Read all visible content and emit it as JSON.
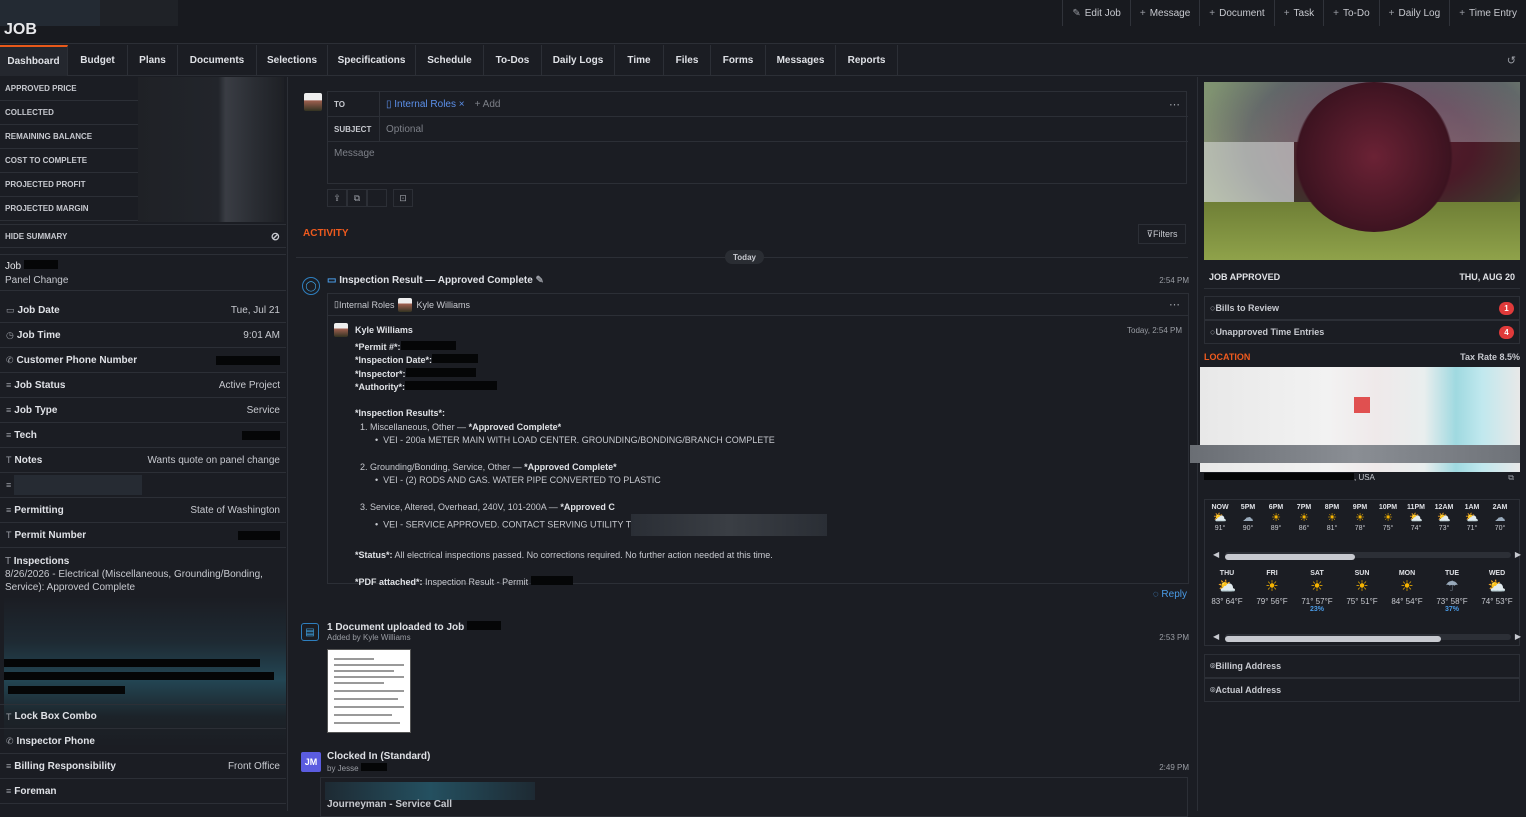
{
  "header": {
    "title": "JOB",
    "actions": [
      {
        "icon": "edit-icon",
        "label": "Edit Job"
      },
      {
        "icon": "plus-icon",
        "label": "Message"
      },
      {
        "icon": "plus-icon",
        "label": "Document"
      },
      {
        "icon": "plus-icon",
        "label": "Task"
      },
      {
        "icon": "plus-icon",
        "label": "To-Do"
      },
      {
        "icon": "plus-icon",
        "label": "Daily Log"
      },
      {
        "icon": "plus-icon",
        "label": "Time Entry"
      }
    ]
  },
  "tabs": [
    "Dashboard",
    "Budget",
    "Plans",
    "Documents",
    "Selections",
    "Specifications",
    "Schedule",
    "To-Dos",
    "Daily Logs",
    "Time",
    "Files",
    "Forms",
    "Messages",
    "Reports"
  ],
  "summary": {
    "rows": [
      "APPROVED PRICE",
      "COLLECTED",
      "REMAINING BALANCE",
      "COST TO COMPLETE",
      "PROJECTED PROFIT",
      "PROJECTED MARGIN"
    ],
    "hide_label": "HIDE SUMMARY"
  },
  "job": {
    "label": "Job",
    "subtitle": "Panel Change"
  },
  "fields": [
    {
      "icon": "calendar-icon",
      "label": "Job Date",
      "value": "Tue, Jul 21"
    },
    {
      "icon": "clock-icon",
      "label": "Job Time",
      "value": "9:01 AM"
    },
    {
      "icon": "phone-icon",
      "label": "Customer Phone Number",
      "value": ""
    },
    {
      "icon": "list-icon",
      "label": "Job Status",
      "value": "Active Project"
    },
    {
      "icon": "list-icon",
      "label": "Job Type",
      "value": "Service"
    },
    {
      "icon": "list-icon",
      "label": "Tech",
      "value": ""
    },
    {
      "icon": "text-icon",
      "label": "Notes",
      "value": "Wants quote on panel change"
    },
    {
      "icon": "list-icon",
      "label": "Permitting",
      "value": "State of Washington"
    },
    {
      "icon": "text-icon",
      "label": "Permit Number",
      "value": ""
    }
  ],
  "inspections": {
    "label": "Inspections",
    "text": "8/26/2026 - Electrical (Miscellaneous, Grounding/Bonding, Service): Approved Complete"
  },
  "fields_bottom": [
    {
      "icon": "text-icon",
      "label": "Lock Box Combo",
      "value": ""
    },
    {
      "icon": "phone-icon",
      "label": "Inspector Phone",
      "value": ""
    },
    {
      "icon": "list-icon",
      "label": "Billing Responsibility",
      "value": "Front Office"
    },
    {
      "icon": "list-icon",
      "label": "Foreman",
      "value": ""
    }
  ],
  "compose": {
    "to_label": "TO",
    "recipient": "Internal Roles",
    "add_label": "+ Add",
    "subject_label": "SUBJECT",
    "subject_placeholder": "Optional",
    "message_placeholder": "Message"
  },
  "activity": {
    "title": "ACTIVITY",
    "filters_label": "Filters",
    "today_label": "Today",
    "inspection": {
      "title": "Inspection Result — Approved Complete",
      "time": "2:54 PM",
      "recipients": [
        "Internal Roles",
        "Kyle Williams"
      ],
      "author": "Kyle Williams",
      "author_time": "Today, 2:54 PM",
      "permit_label": "*Permit #*:",
      "date_label": "*Inspection Date*:",
      "inspector_label": "*Inspector*:",
      "authority_label": "*Authority*:",
      "results_label": "*Inspection Results*:",
      "r1": "1. Miscellaneous, Other — ",
      "r1b": "*Approved Complete*",
      "r1d": "VEI - 200a METER MAIN WITH LOAD CENTER. GROUNDING/BONDING/BRANCH COMPLETE",
      "r2": "2. Grounding/Bonding, Service, Other — ",
      "r2b": "*Approved Complete*",
      "r2d": "VEI - (2) RODS AND GAS. WATER PIPE CONVERTED TO PLASTIC",
      "r3": "3. Service, Altered, Overhead, 240V, 101-200A — ",
      "r3b": "*Approved C",
      "r3d": "VEI - SERVICE APPROVED. CONTACT SERVING UTILITY T",
      "status_label": "*Status*:",
      "status_text": "All electrical inspections passed. No corrections required. No further action needed at this time.",
      "pdf_label": "*PDF attached*:",
      "pdf_text": "Inspection Result - Permit",
      "reply_label": "Reply"
    },
    "document": {
      "title": "1 Document uploaded to Job",
      "added_by": "Added by Kyle Williams",
      "time": "2:53 PM"
    },
    "clock": {
      "initials": "JM",
      "title": "Clocked In (Standard)",
      "by": "by Jesse",
      "time": "2:49 PM",
      "note": "Journeyman - Service Call"
    }
  },
  "right": {
    "status": "JOB APPROVED",
    "date": "THU, AUG 20",
    "todos": [
      {
        "label": "Bills to Review",
        "count": "1"
      },
      {
        "label": "Unapproved Time Entries",
        "count": "4"
      }
    ],
    "location_title": "LOCATION",
    "tax_rate": "Tax Rate 8.5%",
    "address_suffix": ", USA",
    "hourly": [
      {
        "h": "NOW",
        "icon": "cloud-sun-icon",
        "t": "91°"
      },
      {
        "h": "5PM",
        "icon": "cloud-icon",
        "t": "90°"
      },
      {
        "h": "6PM",
        "icon": "sun-icon",
        "t": "89°"
      },
      {
        "h": "7PM",
        "icon": "sun-icon",
        "t": "86°"
      },
      {
        "h": "8PM",
        "icon": "sun-icon",
        "t": "81°"
      },
      {
        "h": "9PM",
        "icon": "sun-icon",
        "t": "78°"
      },
      {
        "h": "10PM",
        "icon": "sun-icon",
        "t": "75°"
      },
      {
        "h": "11PM",
        "icon": "cloud-sun-icon",
        "t": "74°"
      },
      {
        "h": "12AM",
        "icon": "cloud-sun-icon",
        "t": "73°"
      },
      {
        "h": "1AM",
        "icon": "cloud-sun-icon",
        "t": "71°"
      },
      {
        "h": "2AM",
        "icon": "cloud-icon",
        "t": "70°"
      }
    ],
    "daily": [
      {
        "d": "THU",
        "icon": "cloud-sun-icon",
        "t": "83° 64°F",
        "p": ""
      },
      {
        "d": "FRI",
        "icon": "sun-icon",
        "t": "79° 56°F",
        "p": ""
      },
      {
        "d": "SAT",
        "icon": "sun-icon",
        "t": "71° 57°F",
        "p": "23%"
      },
      {
        "d": "SUN",
        "icon": "sun-icon",
        "t": "75° 51°F",
        "p": ""
      },
      {
        "d": "MON",
        "icon": "sun-icon",
        "t": "84° 54°F",
        "p": ""
      },
      {
        "d": "TUE",
        "icon": "rain-icon",
        "t": "73° 58°F",
        "p": "37%"
      },
      {
        "d": "WED",
        "icon": "cloud-sun-icon",
        "t": "74° 53°F",
        "p": ""
      }
    ],
    "billing_address": "Billing Address",
    "actual_address": "Actual Address"
  }
}
